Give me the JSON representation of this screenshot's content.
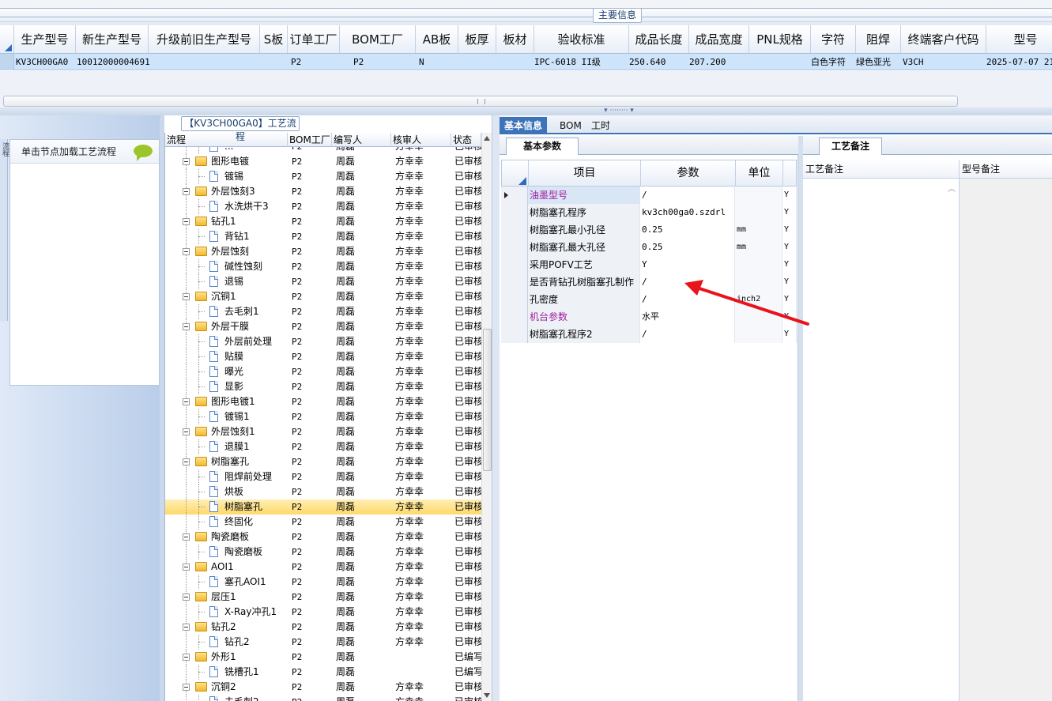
{
  "main_info": {
    "title": "主要信息",
    "columns": [
      "生产型号",
      "新生产型号",
      "升级前旧生产型号",
      "S板",
      "订单工厂",
      "BOM工厂",
      "AB板",
      "板厚",
      "板材",
      "验收标准",
      "成品长度",
      "成品宽度",
      "PNL规格",
      "字符",
      "阻焊",
      "终端客户代码",
      "型号"
    ],
    "row": {
      "prod_model": "KV3CH00GA0",
      "new_prod_model": "10012000004691",
      "old_model": "",
      "s_board": "",
      "order_factory": "P2",
      "bom_factory": "P2",
      "ab_board": "N",
      "thickness": "",
      "material": "",
      "standard": "IPC-6018 II级",
      "length": "250.640",
      "width": "207.200",
      "pnl": "",
      "char": "白色字符",
      "solder": "绿色亚光",
      "customer": "V3CH",
      "date": "2025-07-07 21:"
    }
  },
  "left": {
    "vtab": "流程",
    "card_label": "单击节点加载工艺流程"
  },
  "process": {
    "title": "【KV3CH00GA0】工艺流程",
    "headers": {
      "name": "流程",
      "bom": "BOM工厂",
      "writer": "编写人",
      "reviewer": "核审人",
      "status": "状态"
    },
    "rows": [
      {
        "level": 2,
        "name": "...",
        "bom": "P2",
        "writer": "周磊",
        "reviewer": "方幸幸",
        "status": "已审核",
        "partial": true
      },
      {
        "level": 1,
        "name": "图形电镀",
        "bom": "P2",
        "writer": "周磊",
        "reviewer": "方幸幸",
        "status": "已审核"
      },
      {
        "level": 2,
        "name": "镀锡",
        "bom": "P2",
        "writer": "周磊",
        "reviewer": "方幸幸",
        "status": "已审核"
      },
      {
        "level": 1,
        "name": "外层蚀刻3",
        "bom": "P2",
        "writer": "周磊",
        "reviewer": "方幸幸",
        "status": "已审核"
      },
      {
        "level": 2,
        "name": "水洗烘干3",
        "bom": "P2",
        "writer": "周磊",
        "reviewer": "方幸幸",
        "status": "已审核"
      },
      {
        "level": 1,
        "name": "钻孔1",
        "bom": "P2",
        "writer": "周磊",
        "reviewer": "方幸幸",
        "status": "已审核"
      },
      {
        "level": 2,
        "name": "背钻1",
        "bom": "P2",
        "writer": "周磊",
        "reviewer": "方幸幸",
        "status": "已审核"
      },
      {
        "level": 1,
        "name": "外层蚀刻",
        "bom": "P2",
        "writer": "周磊",
        "reviewer": "方幸幸",
        "status": "已审核"
      },
      {
        "level": 2,
        "name": "碱性蚀刻",
        "bom": "P2",
        "writer": "周磊",
        "reviewer": "方幸幸",
        "status": "已审核"
      },
      {
        "level": 2,
        "name": "退锡",
        "bom": "P2",
        "writer": "周磊",
        "reviewer": "方幸幸",
        "status": "已审核"
      },
      {
        "level": 1,
        "name": "沉铜1",
        "bom": "P2",
        "writer": "周磊",
        "reviewer": "方幸幸",
        "status": "已审核"
      },
      {
        "level": 2,
        "name": "去毛刺1",
        "bom": "P2",
        "writer": "周磊",
        "reviewer": "方幸幸",
        "status": "已审核"
      },
      {
        "level": 1,
        "name": "外层干膜",
        "bom": "P2",
        "writer": "周磊",
        "reviewer": "方幸幸",
        "status": "已审核"
      },
      {
        "level": 2,
        "name": "外层前处理",
        "bom": "P2",
        "writer": "周磊",
        "reviewer": "方幸幸",
        "status": "已审核"
      },
      {
        "level": 2,
        "name": "贴膜",
        "bom": "P2",
        "writer": "周磊",
        "reviewer": "方幸幸",
        "status": "已审核"
      },
      {
        "level": 2,
        "name": "曝光",
        "bom": "P2",
        "writer": "周磊",
        "reviewer": "方幸幸",
        "status": "已审核"
      },
      {
        "level": 2,
        "name": "显影",
        "bom": "P2",
        "writer": "周磊",
        "reviewer": "方幸幸",
        "status": "已审核"
      },
      {
        "level": 1,
        "name": "图形电镀1",
        "bom": "P2",
        "writer": "周磊",
        "reviewer": "方幸幸",
        "status": "已审核"
      },
      {
        "level": 2,
        "name": "镀锡1",
        "bom": "P2",
        "writer": "周磊",
        "reviewer": "方幸幸",
        "status": "已审核"
      },
      {
        "level": 1,
        "name": "外层蚀刻1",
        "bom": "P2",
        "writer": "周磊",
        "reviewer": "方幸幸",
        "status": "已审核"
      },
      {
        "level": 2,
        "name": "退膜1",
        "bom": "P2",
        "writer": "周磊",
        "reviewer": "方幸幸",
        "status": "已审核"
      },
      {
        "level": 1,
        "name": "树脂塞孔",
        "bom": "P2",
        "writer": "周磊",
        "reviewer": "方幸幸",
        "status": "已审核"
      },
      {
        "level": 2,
        "name": "阻焊前处理",
        "bom": "P2",
        "writer": "周磊",
        "reviewer": "方幸幸",
        "status": "已审核"
      },
      {
        "level": 2,
        "name": "烘板",
        "bom": "P2",
        "writer": "周磊",
        "reviewer": "方幸幸",
        "status": "已审核"
      },
      {
        "level": 2,
        "name": "树脂塞孔",
        "bom": "P2",
        "writer": "周磊",
        "reviewer": "方幸幸",
        "status": "已审核",
        "selected": true
      },
      {
        "level": 2,
        "name": "终固化",
        "bom": "P2",
        "writer": "周磊",
        "reviewer": "方幸幸",
        "status": "已审核"
      },
      {
        "level": 1,
        "name": "陶瓷磨板",
        "bom": "P2",
        "writer": "周磊",
        "reviewer": "方幸幸",
        "status": "已审核"
      },
      {
        "level": 2,
        "name": "陶瓷磨板",
        "bom": "P2",
        "writer": "周磊",
        "reviewer": "方幸幸",
        "status": "已审核"
      },
      {
        "level": 1,
        "name": "AOI1",
        "bom": "P2",
        "writer": "周磊",
        "reviewer": "方幸幸",
        "status": "已审核"
      },
      {
        "level": 2,
        "name": "塞孔AOI1",
        "bom": "P2",
        "writer": "周磊",
        "reviewer": "方幸幸",
        "status": "已审核"
      },
      {
        "level": 1,
        "name": "层压1",
        "bom": "P2",
        "writer": "周磊",
        "reviewer": "方幸幸",
        "status": "已审核"
      },
      {
        "level": 2,
        "name": "X-Ray冲孔1",
        "bom": "P2",
        "writer": "周磊",
        "reviewer": "方幸幸",
        "status": "已审核"
      },
      {
        "level": 1,
        "name": "钻孔2",
        "bom": "P2",
        "writer": "周磊",
        "reviewer": "方幸幸",
        "status": "已审核"
      },
      {
        "level": 2,
        "name": "钻孔2",
        "bom": "P2",
        "writer": "周磊",
        "reviewer": "方幸幸",
        "status": "已审核"
      },
      {
        "level": 1,
        "name": "外形1",
        "bom": "P2",
        "writer": "周磊",
        "reviewer": "",
        "status": "已编写"
      },
      {
        "level": 2,
        "name": "铣槽孔1",
        "bom": "P2",
        "writer": "周磊",
        "reviewer": "",
        "status": "已编写"
      },
      {
        "level": 1,
        "name": "沉铜2",
        "bom": "P2",
        "writer": "周磊",
        "reviewer": "方幸幸",
        "status": "已审核"
      },
      {
        "level": 2,
        "name": "去毛刺2",
        "bom": "P2",
        "writer": "周磊",
        "reviewer": "方幸幸",
        "status": "已审核",
        "partial": true
      }
    ]
  },
  "tabs": {
    "basic": "基本信息",
    "bom": "BOM",
    "hours": "工时"
  },
  "basic_params": {
    "tab": "基本参数",
    "headers": {
      "item": "项目",
      "param": "参数",
      "unit": "单位"
    },
    "rows": [
      {
        "item": "油墨型号",
        "param": "/",
        "unit": "",
        "flag": "Y",
        "purple": true,
        "current": true
      },
      {
        "item": "树脂塞孔程序",
        "param": "kv3ch00ga0.szdrl",
        "unit": "",
        "flag": "Y"
      },
      {
        "item": "树脂塞孔最小孔径",
        "param": "0.25",
        "unit": "mm",
        "flag": "Y"
      },
      {
        "item": "树脂塞孔最大孔径",
        "param": "0.25",
        "unit": "mm",
        "flag": "Y"
      },
      {
        "item": "采用POFV工艺",
        "param": "Y",
        "unit": "",
        "flag": "Y"
      },
      {
        "item": "是否背钻孔树脂塞孔制作",
        "param": "/",
        "unit": "",
        "flag": "Y"
      },
      {
        "item": "孔密度",
        "param": "/",
        "unit": "inch2",
        "flag": "Y"
      },
      {
        "item": "机台参数",
        "param": "水平",
        "unit": "",
        "flag": "Y",
        "purple": true
      },
      {
        "item": "树脂塞孔程序2",
        "param": "/",
        "unit": "",
        "flag": "Y"
      }
    ]
  },
  "remarks": {
    "tab": "工艺备注",
    "col1": "工艺备注",
    "col2": "型号备注"
  },
  "colors": {
    "accent": "#3d73b8",
    "selection": "#cde4fb",
    "arrow": "#e8141c",
    "highlight": "#ffd86a"
  }
}
